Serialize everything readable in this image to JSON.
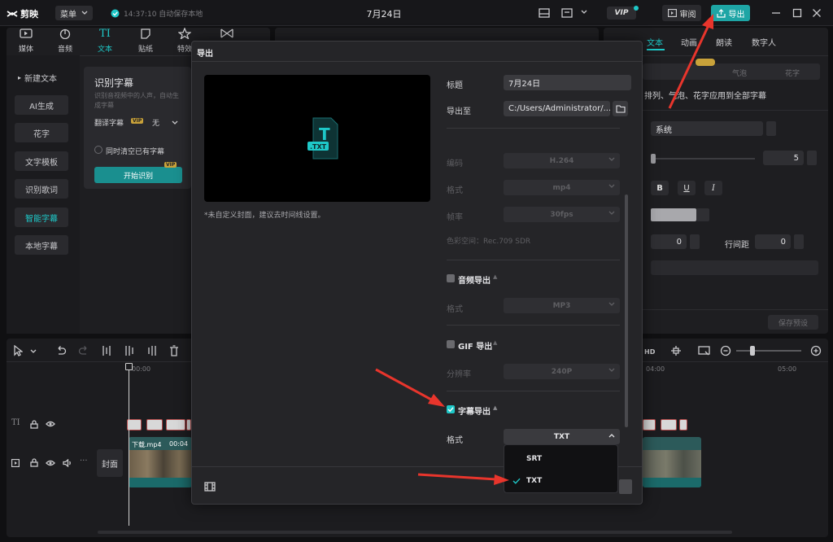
{
  "app": {
    "logo": "剪映",
    "menu_label": "菜单",
    "save_status": "14:37:10 自动保存本地",
    "project_title": "7月24日",
    "vip_badge": "VIP",
    "review_label": "审阅",
    "export_label": "导出"
  },
  "media_tabs": [
    {
      "label": "媒体"
    },
    {
      "label": "音频"
    },
    {
      "label": "文本"
    },
    {
      "label": "贴纸"
    },
    {
      "label": "特效"
    },
    {
      "label": "转场"
    }
  ],
  "text_sidebar": [
    {
      "label": "新建文本"
    },
    {
      "label": "AI生成"
    },
    {
      "label": "花字"
    },
    {
      "label": "文字模板"
    },
    {
      "label": "识别歌词"
    },
    {
      "label": "智能字幕"
    },
    {
      "label": "本地字幕"
    }
  ],
  "caption_card": {
    "title": "识别字幕",
    "desc": "识别音视频中的人声，自动生成字幕",
    "translate_label": "翻译字幕",
    "translate_value": "无",
    "clear_label": "同时清空已有字幕",
    "start_button": "开始识别",
    "vip": "VIP"
  },
  "right_panel": {
    "tabs": [
      "文本",
      "动画",
      "朗读",
      "数字人"
    ],
    "sub_tabs": [
      "花字",
      "气泡"
    ],
    "apply_text": "排列、气泡、花字应用到全部字幕",
    "font_value": "系统",
    "size_value": "5",
    "spacing_value": "0",
    "line_spacing_label": "行间距",
    "line_spacing_value": "0",
    "save_preset": "保存预设"
  },
  "timeline": {
    "time_start": "00:00",
    "time_mid": "04:00",
    "time_end": "05:00",
    "video_clip_name": "下载.mp4",
    "video_clip_time": "00:04",
    "cover_label": "封面"
  },
  "export_dialog": {
    "title": "导出",
    "preview_file_label": ".TXT",
    "cover_hint": "*未自定义封面，建议去时间线设置。",
    "title_label": "标题",
    "title_value": "7月24日",
    "export_to_label": "导出至",
    "export_to_value": "C:/Users/Administrator/...",
    "encode_label": "编码",
    "encode_value": "H.264",
    "format_label": "格式",
    "format_value": "mp4",
    "fps_label": "帧率",
    "fps_value": "30fps",
    "color_space_label": "色彩空间：Rec.709 SDR",
    "audio_section": "音频导出",
    "audio_format_label": "格式",
    "audio_format_value": "MP3",
    "gif_section": "GIF 导出",
    "gif_res_label": "分辨率",
    "gif_res_value": "240P",
    "subtitle_section": "字幕导出",
    "subtitle_format_label": "格式",
    "subtitle_format_value": "TXT",
    "subtitle_options": [
      {
        "label": "SRT",
        "selected": false
      },
      {
        "label": "TXT",
        "selected": true
      }
    ]
  },
  "colors": {
    "accent": "#1ec8c8",
    "arrow": "#e8352c",
    "panel": "#1e1e21",
    "dialog": "#252528"
  }
}
